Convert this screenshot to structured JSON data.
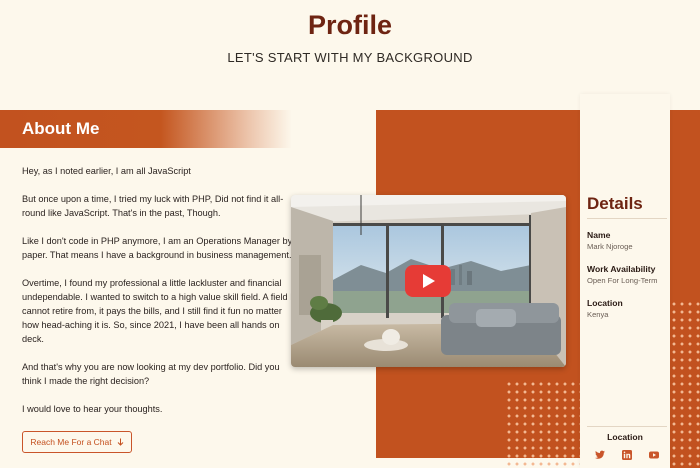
{
  "header": {
    "title": "Profile",
    "subtitle": "LET'S START WITH MY BACKGROUND"
  },
  "about": {
    "heading": "About Me",
    "paragraphs": [
      "Hey, as I noted earlier, I am all JavaScript",
      "But once upon a time, I tried my luck with PHP, Did not find it all-round like JavaScript. That's in the past, Though.",
      "Like I don't code in PHP anymore, I am an Operations Manager by paper. That means I have a background in business management.",
      "Overtime, I found my professional a little lackluster and financial undependable. I wanted to switch to a  high value skill field. A field I cannot retire from, it pays the bills, and I still find it fun no matter how head-aching it is. So, since 2021, I have been all hands on deck.",
      "And that's why you are now looking at my dev portfolio. Did you think I made the right decision?",
      "I would love to hear your thoughts."
    ],
    "cta_label": "Reach Me For a Chat",
    "cta_icon": "arrow-down-icon"
  },
  "video": {
    "play_icon": "youtube-play-icon"
  },
  "details": {
    "title": "Details",
    "items": [
      {
        "label": "Name",
        "value": "Mark Njoroge"
      },
      {
        "label": "Work Availability",
        "value": "Open For Long-Term"
      },
      {
        "label": "Location",
        "value": "Kenya"
      }
    ],
    "location_heading": "Location",
    "social_icons": [
      "twitter-icon",
      "linkedin-icon",
      "youtube-icon"
    ]
  },
  "colors": {
    "accent": "#c2521f",
    "heading": "#6e2412",
    "background": "#fdf8ec"
  }
}
